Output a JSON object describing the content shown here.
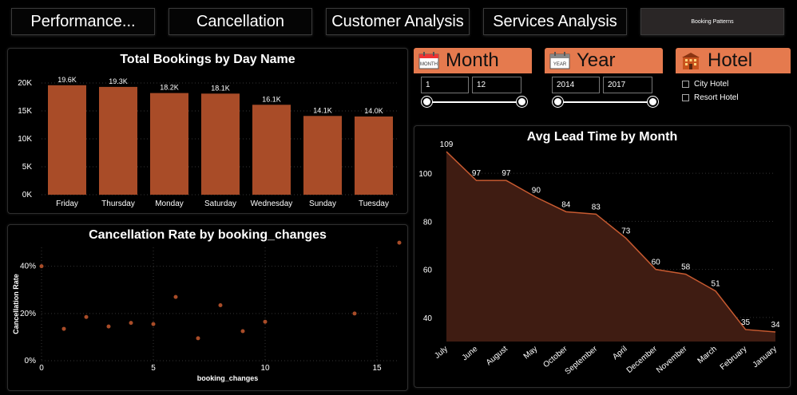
{
  "nav": {
    "tabs": [
      {
        "label": "Performance..."
      },
      {
        "label": "Cancellation"
      },
      {
        "label": "Customer Analysis"
      },
      {
        "label": "Services Analysis"
      },
      {
        "label": "Booking Patterns"
      }
    ]
  },
  "slicers": {
    "month": {
      "title": "Month",
      "icon": "calendar-month-icon",
      "from": "1",
      "to": "12"
    },
    "year": {
      "title": "Year",
      "icon": "calendar-year-icon",
      "from": "2014",
      "to": "2017"
    },
    "hotel": {
      "title": "Hotel",
      "icon": "hotel-building-icon",
      "options": [
        "City Hotel",
        "Resort Hotel"
      ]
    }
  },
  "colors": {
    "accent": "#e57a4e",
    "bar": "#a94c28",
    "area_fill": "#3f1c12",
    "area_line": "#c75a30"
  },
  "chart_data": [
    {
      "type": "bar",
      "title": "Total Bookings by Day Name",
      "categories": [
        "Friday",
        "Thursday",
        "Monday",
        "Saturday",
        "Wednesday",
        "Sunday",
        "Tuesday"
      ],
      "values": [
        19.6,
        19.3,
        18.2,
        18.1,
        16.1,
        14.1,
        14.0
      ],
      "data_labels": [
        "19.6K",
        "19.3K",
        "18.2K",
        "18.1K",
        "16.1K",
        "14.1K",
        "14.0K"
      ],
      "yticks": [
        "0K",
        "5K",
        "10K",
        "15K",
        "20K"
      ],
      "ylim": [
        0,
        20
      ]
    },
    {
      "type": "scatter",
      "title": "Cancellation Rate by booking_changes",
      "xlabel": "booking_changes",
      "ylabel": "Cancellation Rate",
      "xticks": [
        "0",
        "5",
        "10",
        "15"
      ],
      "yticks": [
        "0%",
        "20%",
        "40%"
      ],
      "xlim": [
        0,
        16
      ],
      "ylim": [
        0,
        48
      ],
      "points": [
        {
          "x": 0,
          "y": 40
        },
        {
          "x": 1,
          "y": 13.5
        },
        {
          "x": 2,
          "y": 18.5
        },
        {
          "x": 3,
          "y": 14.5
        },
        {
          "x": 4,
          "y": 16
        },
        {
          "x": 5,
          "y": 15.5
        },
        {
          "x": 6,
          "y": 27
        },
        {
          "x": 7,
          "y": 9.5
        },
        {
          "x": 8,
          "y": 23.5
        },
        {
          "x": 9,
          "y": 12.5
        },
        {
          "x": 10,
          "y": 16.5
        },
        {
          "x": 14,
          "y": 20
        },
        {
          "x": 16,
          "y": 50
        }
      ]
    },
    {
      "type": "area",
      "title": "Avg Lead Time by Month",
      "categories": [
        "July",
        "June",
        "August",
        "May",
        "October",
        "September",
        "April",
        "December",
        "November",
        "March",
        "February",
        "January"
      ],
      "values": [
        109,
        97,
        97,
        90,
        84,
        83,
        73,
        60,
        58,
        51,
        35,
        34
      ],
      "yticks": [
        "40",
        "60",
        "80",
        "100"
      ],
      "ylim": [
        30,
        111
      ]
    }
  ]
}
